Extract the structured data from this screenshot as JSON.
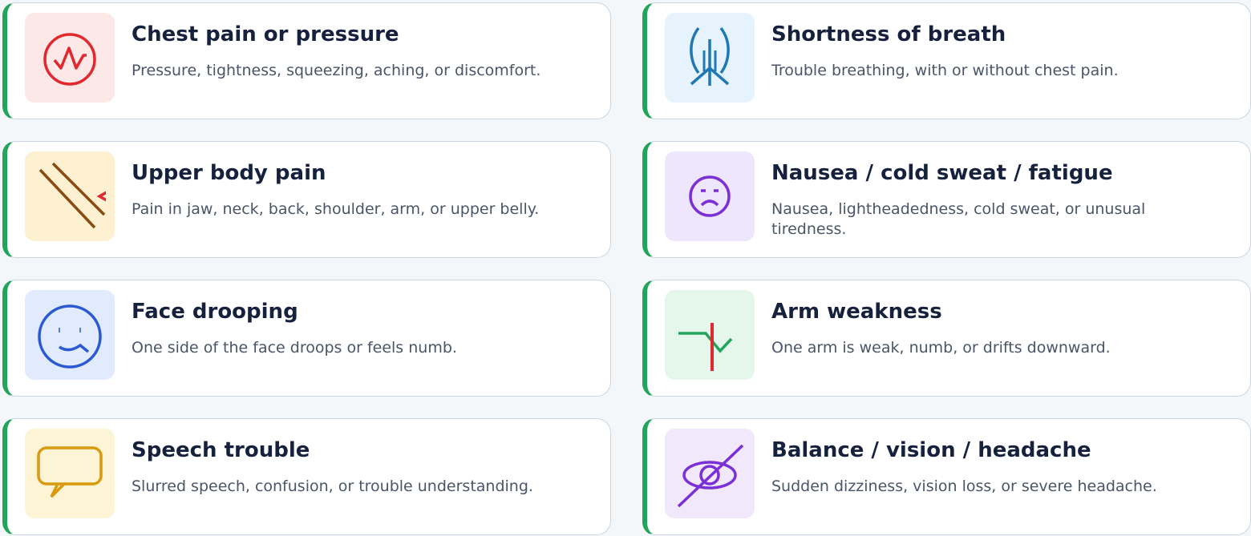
{
  "cards": [
    {
      "title": "Chest pain or pressure",
      "desc": "Pressure, tightness, squeezing, aching, or discomfort.",
      "icon": "heart-pulse-icon",
      "icon_bg": "#fde8e8",
      "icon_color": "#e0282e"
    },
    {
      "title": "Shortness of breath",
      "desc": "Trouble breathing, with or without chest pain.",
      "icon": "lungs-icon",
      "icon_bg": "#e6f3fc",
      "icon_color": "#1f78b4"
    },
    {
      "title": "Upper body pain",
      "desc": "Pain in jaw, neck, back, shoulder, arm, or upper belly.",
      "icon": "radiating-pain-icon",
      "icon_bg": "#fdf1d2",
      "icon_color": "#8a4a12"
    },
    {
      "title": "Nausea / cold sweat / fatigue",
      "desc": "Nausea, lightheadedness, cold sweat, or unusual tiredness.",
      "icon": "sad-face-icon",
      "icon_bg": "#eee6fc",
      "icon_color": "#7b2fd6"
    },
    {
      "title": "Face drooping",
      "desc": "One side of the face droops or feels numb.",
      "icon": "drooping-face-icon",
      "icon_bg": "#e1ebfd",
      "icon_color": "#2b59d1"
    },
    {
      "title": "Arm weakness",
      "desc": "One arm is weak, numb, or drifts downward.",
      "icon": "arm-drift-icon",
      "icon_bg": "#e5f6ea",
      "icon_color": "#22a55b"
    },
    {
      "title": "Speech trouble",
      "desc": "Slurred speech, confusion, or trouble understanding.",
      "icon": "speech-bubble-icon",
      "icon_bg": "#fdf4d6",
      "icon_color": "#d99a0e"
    },
    {
      "title": "Balance / vision / headache",
      "desc": "Sudden dizziness, vision loss, or severe headache.",
      "icon": "eye-slash-icon",
      "icon_bg": "#f1e8fc",
      "icon_color": "#7b2fd6"
    }
  ],
  "colors": {
    "accent_bar": "#22a55b",
    "title": "#16213e",
    "text": "#4a5568"
  }
}
